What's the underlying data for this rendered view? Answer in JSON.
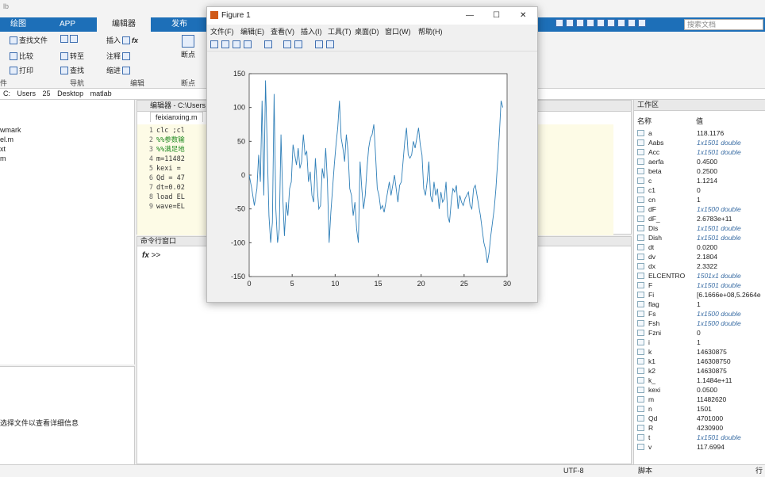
{
  "app": {
    "title_fragment": "lb"
  },
  "ribbon": {
    "tabs": [
      "绘图",
      "APP",
      "编辑器",
      "发布"
    ],
    "active_tab": "编辑器",
    "buttons": {
      "find_files": "查找文件",
      "compare": "比较",
      "print": "打印",
      "go_back": "",
      "goto": "转至",
      "find": "查找",
      "insert": "插入",
      "fx": "fx",
      "comment": "注释",
      "indent": "缩进",
      "breakpoints": "断点",
      "run_sec": ""
    },
    "sections": [
      "件",
      "导航",
      "编辑",
      "断点"
    ],
    "search_placeholder": "搜索文档"
  },
  "address": {
    "parts": [
      "C:",
      "Users",
      "25",
      "Desktop",
      "matlab"
    ]
  },
  "folder": {
    "files": [
      "wmark",
      "el.m",
      "xt",
      "m"
    ]
  },
  "detail": {
    "hint": "选择文件以查看详细信息"
  },
  "editor": {
    "header": "编辑器 - C:\\Users",
    "tab": "feixianxing.m",
    "lines": [
      {
        "n": "1",
        "t": "clc ;cl"
      },
      {
        "n": "2",
        "t": "%%参数输"
      },
      {
        "n": "3",
        "t": "%%满足地"
      },
      {
        "n": "4",
        "t": "m=11482"
      },
      {
        "n": "5",
        "t": "kexi ="
      },
      {
        "n": "6",
        "t": "Qd = 47"
      },
      {
        "n": "7",
        "t": "dt=0.02"
      },
      {
        "n": "8",
        "t": "load EL"
      },
      {
        "n": "9",
        "t": "wave=EL"
      }
    ]
  },
  "cmd": {
    "title": "命令行窗口",
    "prompt": ">>",
    "fx": "fx"
  },
  "workspace": {
    "title": "工作区",
    "col_name": "名称",
    "col_value": "值",
    "vars": [
      {
        "name": "a",
        "value": "118.1176"
      },
      {
        "name": "Aabs",
        "value": "1x1501 double",
        "it": true
      },
      {
        "name": "Acc",
        "value": "1x1501 double",
        "it": true
      },
      {
        "name": "aerfa",
        "value": "0.4500"
      },
      {
        "name": "beta",
        "value": "0.2500"
      },
      {
        "name": "c",
        "value": "1.1214"
      },
      {
        "name": "c1",
        "value": "0"
      },
      {
        "name": "cn",
        "value": "1"
      },
      {
        "name": "dF",
        "value": "1x1500 double",
        "it": true
      },
      {
        "name": "dF_",
        "value": "2.6783e+11"
      },
      {
        "name": "Dis",
        "value": "1x1501 double",
        "it": true
      },
      {
        "name": "Dish",
        "value": "1x1501 double",
        "it": true
      },
      {
        "name": "dt",
        "value": "0.0200"
      },
      {
        "name": "dv",
        "value": "2.1804"
      },
      {
        "name": "dx",
        "value": "2.3322"
      },
      {
        "name": "ELCENTRO",
        "value": "1501x1 double",
        "it": true
      },
      {
        "name": "F",
        "value": "1x1501 double",
        "it": true
      },
      {
        "name": "Fi",
        "value": "[6.1666e+08,5.2664e"
      },
      {
        "name": "flag",
        "value": "1"
      },
      {
        "name": "Fs",
        "value": "1x1500 double",
        "it": true
      },
      {
        "name": "Fsh",
        "value": "1x1500 double",
        "it": true
      },
      {
        "name": "Fzni",
        "value": "0"
      },
      {
        "name": "i",
        "value": "1"
      },
      {
        "name": "k",
        "value": "14630875"
      },
      {
        "name": "k1",
        "value": "146308750"
      },
      {
        "name": "k2",
        "value": "14630875"
      },
      {
        "name": "k_",
        "value": "1.1484e+11"
      },
      {
        "name": "kexi",
        "value": "0.0500"
      },
      {
        "name": "m",
        "value": "11482620"
      },
      {
        "name": "n",
        "value": "1501"
      },
      {
        "name": "Qd",
        "value": "4701000"
      },
      {
        "name": "R",
        "value": "4230900"
      },
      {
        "name": "t",
        "value": "1x1501 double",
        "it": true
      },
      {
        "name": "v",
        "value": "117.6994"
      }
    ]
  },
  "status": {
    "encoding": "UTF-8",
    "mode": "脚本",
    "pos": "行"
  },
  "figure": {
    "title": "Figure 1",
    "menus": [
      "文件(F)",
      "编辑(E)",
      "查看(V)",
      "插入(I)",
      "工具(T)",
      "桌面(D)",
      "窗口(W)",
      "帮助(H)"
    ],
    "line_color": "#2f7fb8"
  },
  "chart_data": {
    "type": "line",
    "xlim": [
      0,
      30
    ],
    "ylim": [
      -150,
      150
    ],
    "xticks": [
      "0",
      "5",
      "10",
      "15",
      "20",
      "25",
      "30"
    ],
    "yticks": [
      "150",
      "100",
      "50",
      "0",
      "-50",
      "-100",
      "-150"
    ],
    "x": [
      0,
      0.3,
      0.6,
      0.9,
      1.1,
      1.3,
      1.5,
      1.7,
      1.9,
      2.1,
      2.3,
      2.5,
      2.7,
      2.9,
      3.1,
      3.3,
      3.5,
      3.7,
      3.9,
      4.1,
      4.3,
      4.5,
      4.7,
      4.9,
      5.1,
      5.3,
      5.5,
      5.7,
      5.9,
      6.1,
      6.3,
      6.5,
      6.7,
      6.9,
      7.1,
      7.3,
      7.5,
      7.7,
      7.9,
      8.1,
      8.3,
      8.5,
      8.7,
      8.9,
      9.1,
      9.3,
      9.5,
      9.7,
      9.9,
      10.1,
      10.3,
      10.5,
      10.7,
      10.9,
      11.1,
      11.3,
      11.5,
      11.7,
      11.9,
      12.1,
      12.3,
      12.5,
      12.7,
      12.9,
      13.1,
      13.3,
      13.5,
      13.7,
      13.9,
      14.1,
      14.3,
      14.5,
      14.7,
      14.9,
      15.1,
      15.3,
      15.5,
      15.7,
      15.9,
      16.1,
      16.3,
      16.5,
      16.7,
      16.9,
      17.1,
      17.3,
      17.5,
      17.7,
      17.9,
      18.1,
      18.3,
      18.5,
      18.7,
      18.9,
      19.1,
      19.3,
      19.5,
      19.7,
      19.9,
      20.1,
      20.3,
      20.5,
      20.7,
      20.9,
      21.1,
      21.3,
      21.5,
      21.7,
      21.9,
      22.1,
      22.3,
      22.5,
      22.7,
      22.9,
      23.1,
      23.3,
      23.5,
      23.7,
      23.9,
      24.1,
      24.3,
      24.5,
      24.7,
      24.9,
      25.1,
      25.3,
      25.5,
      25.7,
      25.9,
      26.1,
      26.3,
      26.5,
      26.7,
      26.9,
      27.1,
      27.3,
      27.5,
      27.7,
      27.9,
      28.1,
      28.3,
      28.5,
      28.7,
      28.9,
      29.1,
      29.3,
      29.5,
      29.7,
      30
    ],
    "y": [
      0,
      -20,
      -45,
      -20,
      30,
      -10,
      110,
      -30,
      140,
      40,
      -60,
      -100,
      -70,
      120,
      -50,
      -100,
      -80,
      60,
      -30,
      -90,
      -40,
      -60,
      -20,
      -10,
      45,
      30,
      15,
      40,
      10,
      20,
      60,
      30,
      35,
      -10,
      5,
      -30,
      -40,
      25,
      -15,
      -50,
      -45,
      10,
      -5,
      40,
      -10,
      -100,
      -55,
      -20,
      15,
      45,
      70,
      110,
      55,
      40,
      20,
      60,
      35,
      -20,
      -30,
      -60,
      -40,
      -80,
      -100,
      20,
      -20,
      -50,
      -30,
      10,
      40,
      55,
      60,
      75,
      30,
      -20,
      -30,
      -50,
      -45,
      -55,
      -40,
      -25,
      -10,
      -30,
      -15,
      0,
      -20,
      -40,
      -15,
      -10,
      20,
      50,
      70,
      30,
      25,
      30,
      50,
      40,
      55,
      70,
      45,
      30,
      -20,
      -30,
      -10,
      20,
      -30,
      -40,
      -10,
      -30,
      -20,
      -50,
      -25,
      -40,
      -35,
      -10,
      -60,
      -70,
      -40,
      -20,
      -25,
      -15,
      -50,
      -30,
      -40,
      -45,
      -35,
      -30,
      -25,
      -45,
      -50,
      -20,
      -15,
      -30,
      -45,
      -60,
      -80,
      -100,
      -110,
      -130,
      -115,
      -90,
      -70,
      -50,
      -20,
      20,
      60,
      110,
      100
    ]
  }
}
